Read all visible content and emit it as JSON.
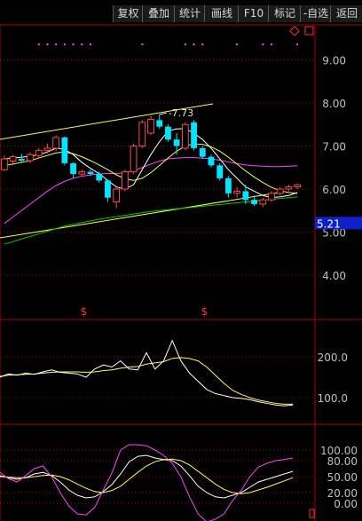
{
  "toolbar": {
    "buttons": [
      {
        "label": "复权",
        "name": "toolbar-button-fuquan"
      },
      {
        "label": "叠加",
        "name": "toolbar-button-diejia"
      },
      {
        "label": "统计",
        "name": "toolbar-button-tongji"
      },
      {
        "label": "画线",
        "name": "toolbar-button-huaxian"
      },
      {
        "label": "F10",
        "name": "toolbar-button-f10"
      },
      {
        "label": "标记",
        "name": "toolbar-button-biaoji"
      },
      {
        "label": "-自选",
        "name": "toolbar-button-zixuan"
      },
      {
        "label": "返回",
        "name": "toolbar-button-fanhui"
      }
    ]
  },
  "icons": {
    "diamond": "diamond-icon",
    "square": "square-icon",
    "flag": "flag-icon"
  },
  "main_chart": {
    "y_ticks": [
      "9.00",
      "8.00",
      "7.00",
      "6.00",
      "5.00",
      "4.00"
    ],
    "current_price": "5.21",
    "high_label": "7.73",
    "marker_symbol": "$",
    "colors": {
      "up": "#ff4848",
      "down": "#00e5ff",
      "ma5": "#ffffff",
      "ma10": "#ffff44",
      "ma20": "#ff40ff",
      "ma60": "#00cc00",
      "trend": "#ffff44",
      "price_tag": "#1020c8",
      "marker": "#ff3030",
      "event_dots": "#ff40ff"
    }
  },
  "volume_chart": {
    "y_ticks": [
      "200.0",
      "100.0"
    ],
    "colors": {
      "line1": "#ffffff",
      "line2": "#ffff44"
    }
  },
  "kdj_chart": {
    "y_ticks": [
      "100.00",
      "80.00",
      "50.00",
      "20.00",
      "0.00"
    ],
    "colors": {
      "k": "#ffffff",
      "d": "#ffff44",
      "j": "#ff40ff"
    }
  },
  "chart_data": {
    "type": "candlestick",
    "y_range": [
      4.0,
      9.0
    ],
    "y_ticks": [
      9.0,
      8.0,
      7.0,
      6.0,
      5.0,
      4.0
    ],
    "annotations": {
      "high": 7.73,
      "current_price": 5.21
    },
    "candles": [
      {
        "o": 6.45,
        "h": 6.78,
        "l": 6.42,
        "c": 6.7
      },
      {
        "o": 6.65,
        "h": 6.8,
        "l": 6.55,
        "c": 6.75
      },
      {
        "o": 6.7,
        "h": 6.82,
        "l": 6.6,
        "c": 6.66
      },
      {
        "o": 6.66,
        "h": 6.85,
        "l": 6.6,
        "c": 6.8
      },
      {
        "o": 6.78,
        "h": 6.95,
        "l": 6.72,
        "c": 6.9
      },
      {
        "o": 6.9,
        "h": 7.05,
        "l": 6.82,
        "c": 6.95
      },
      {
        "o": 6.95,
        "h": 7.25,
        "l": 6.88,
        "c": 7.2
      },
      {
        "o": 7.2,
        "h": 7.22,
        "l": 6.55,
        "c": 6.6
      },
      {
        "o": 6.6,
        "h": 6.62,
        "l": 6.25,
        "c": 6.35
      },
      {
        "o": 6.35,
        "h": 6.45,
        "l": 6.28,
        "c": 6.4
      },
      {
        "o": 6.4,
        "h": 6.45,
        "l": 6.3,
        "c": 6.35
      },
      {
        "o": 6.35,
        "h": 6.4,
        "l": 6.15,
        "c": 6.2
      },
      {
        "o": 6.2,
        "h": 6.22,
        "l": 5.7,
        "c": 5.8
      },
      {
        "o": 5.7,
        "h": 6.05,
        "l": 5.55,
        "c": 6.0
      },
      {
        "o": 6.0,
        "h": 6.45,
        "l": 5.95,
        "c": 6.4
      },
      {
        "o": 6.4,
        "h": 7.05,
        "l": 6.35,
        "c": 7.0
      },
      {
        "o": 7.0,
        "h": 7.6,
        "l": 6.95,
        "c": 7.55
      },
      {
        "o": 7.3,
        "h": 7.7,
        "l": 7.25,
        "c": 7.62
      },
      {
        "o": 7.6,
        "h": 7.73,
        "l": 7.4,
        "c": 7.45
      },
      {
        "o": 7.45,
        "h": 7.5,
        "l": 7.1,
        "c": 7.15
      },
      {
        "o": 7.15,
        "h": 7.3,
        "l": 6.8,
        "c": 7.0
      },
      {
        "o": 6.95,
        "h": 7.55,
        "l": 6.9,
        "c": 7.5
      },
      {
        "o": 7.55,
        "h": 7.6,
        "l": 6.9,
        "c": 6.95
      },
      {
        "o": 6.95,
        "h": 7.0,
        "l": 6.7,
        "c": 6.75
      },
      {
        "o": 6.75,
        "h": 6.8,
        "l": 6.5,
        "c": 6.55
      },
      {
        "o": 6.55,
        "h": 6.6,
        "l": 6.2,
        "c": 6.25
      },
      {
        "o": 6.25,
        "h": 6.3,
        "l": 5.8,
        "c": 5.9
      },
      {
        "o": 5.9,
        "h": 6.05,
        "l": 5.8,
        "c": 5.95
      },
      {
        "o": 5.95,
        "h": 6.1,
        "l": 5.65,
        "c": 5.75
      },
      {
        "o": 5.75,
        "h": 5.85,
        "l": 5.6,
        "c": 5.65
      },
      {
        "o": 5.65,
        "h": 5.8,
        "l": 5.58,
        "c": 5.75
      },
      {
        "o": 5.75,
        "h": 5.95,
        "l": 5.7,
        "c": 5.9
      },
      {
        "o": 5.9,
        "h": 6.05,
        "l": 5.85,
        "c": 6.0
      },
      {
        "o": 6.0,
        "h": 6.1,
        "l": 5.95,
        "c": 6.05
      },
      {
        "o": 6.05,
        "h": 6.12,
        "l": 6.0,
        "c": 6.1
      }
    ],
    "ma5": [
      6.7,
      6.72,
      6.74,
      6.76,
      6.8,
      6.86,
      6.95,
      6.92,
      6.8,
      6.62,
      6.48,
      6.36,
      6.2,
      6.05,
      6.0,
      6.1,
      6.45,
      6.8,
      7.1,
      7.35,
      7.4,
      7.4,
      7.3,
      7.15,
      6.95,
      6.7,
      6.45,
      6.25,
      6.05,
      5.95,
      5.85,
      5.8,
      5.82,
      5.85,
      5.92
    ],
    "ma10": [
      6.55,
      6.58,
      6.62,
      6.66,
      6.72,
      6.78,
      6.84,
      6.86,
      6.82,
      6.75,
      6.66,
      6.56,
      6.45,
      6.33,
      6.24,
      6.2,
      6.25,
      6.38,
      6.55,
      6.72,
      6.88,
      7.0,
      7.05,
      7.04,
      6.98,
      6.88,
      6.74,
      6.58,
      6.42,
      6.28,
      6.15,
      6.04,
      5.96,
      5.92,
      5.9
    ],
    "ma20": [
      5.2,
      5.35,
      5.5,
      5.65,
      5.8,
      5.95,
      6.08,
      6.18,
      6.25,
      6.3,
      6.33,
      6.35,
      6.36,
      6.36,
      6.38,
      6.42,
      6.5,
      6.58,
      6.65,
      6.7,
      6.72,
      6.73,
      6.73,
      6.72,
      6.7,
      6.67,
      6.63,
      6.59,
      6.56,
      6.54,
      6.53,
      6.52,
      6.52,
      6.53,
      6.54
    ],
    "ma60": [
      4.72,
      4.78,
      4.84,
      4.9,
      4.96,
      5.02,
      5.08,
      5.14,
      5.18,
      5.22,
      5.26,
      5.3,
      5.33,
      5.36,
      5.39,
      5.42,
      5.45,
      5.48,
      5.5,
      5.52,
      5.54,
      5.56,
      5.58,
      5.6,
      5.62,
      5.64,
      5.66,
      5.68,
      5.7,
      5.72,
      5.74,
      5.76,
      5.78,
      5.8,
      5.82
    ],
    "trend_upper": [
      [
        6.85,
        7.0
      ],
      [
        7.0,
        8.0
      ]
    ],
    "volume_ma": {
      "line1": [
        150,
        158,
        155,
        160,
        157,
        163,
        168,
        162,
        160,
        158,
        150,
        170,
        180,
        175,
        190,
        170,
        168,
        210,
        170,
        190,
        240,
        190,
        160,
        140,
        120,
        110,
        105,
        100,
        98,
        95,
        90,
        86,
        82,
        80,
        82
      ],
      "line2": [
        152,
        155,
        156,
        157,
        158,
        160,
        162,
        163,
        163,
        163,
        162,
        163,
        166,
        168,
        172,
        175,
        176,
        182,
        185,
        188,
        196,
        198,
        196,
        190,
        175,
        155,
        135,
        118,
        108,
        100,
        94,
        90,
        86,
        84,
        84
      ]
    },
    "kdj": {
      "k": [
        52,
        48,
        45,
        48,
        55,
        58,
        52,
        40,
        25,
        15,
        10,
        12,
        22,
        35,
        55,
        78,
        88,
        90,
        85,
        82,
        80,
        70,
        52,
        32,
        20,
        12,
        10,
        15,
        20,
        30,
        40,
        45,
        50,
        55,
        60
      ],
      "d": [
        50,
        49,
        48,
        48,
        50,
        52,
        53,
        50,
        44,
        36,
        28,
        22,
        20,
        24,
        32,
        45,
        58,
        70,
        78,
        82,
        83,
        80,
        72,
        60,
        48,
        36,
        26,
        20,
        18,
        20,
        25,
        30,
        36,
        42,
        48
      ],
      "j": [
        58,
        46,
        40,
        52,
        65,
        70,
        50,
        20,
        -5,
        -20,
        -22,
        -8,
        25,
        57,
        100,
        110,
        110,
        108,
        100,
        90,
        75,
        50,
        12,
        -20,
        -35,
        -30,
        -20,
        5,
        24,
        50,
        68,
        75,
        80,
        82,
        85
      ]
    },
    "event_dots_index": [
      4,
      5,
      6,
      7,
      8,
      9,
      10,
      16,
      21,
      22,
      23,
      27,
      30,
      31,
      34
    ],
    "markers_index": [
      9,
      23
    ]
  }
}
